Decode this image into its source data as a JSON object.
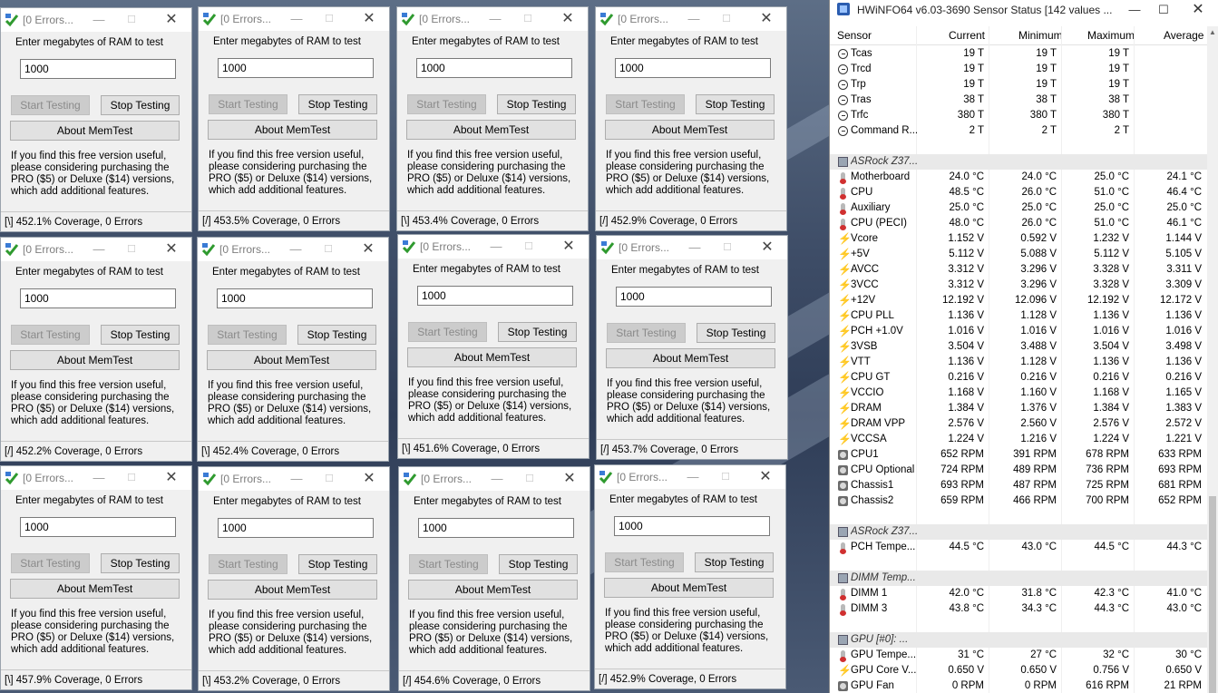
{
  "memtest": {
    "title": "[0 Errors...",
    "prompt": "Enter megabytes of RAM to test",
    "start_label": "Start Testing",
    "stop_label": "Stop Testing",
    "about_label": "About MemTest",
    "description": "If you find this free version useful, please considering purchasing the PRO ($5) or Deluxe ($14) versions, which add additional features.",
    "windows": [
      {
        "ram": "1000",
        "status": "[\\]   452.1% Coverage, 0 Errors"
      },
      {
        "ram": "1000",
        "status": "[/]   453.5% Coverage, 0 Errors"
      },
      {
        "ram": "1000",
        "status": "[\\]   453.4% Coverage, 0 Errors"
      },
      {
        "ram": "1000",
        "status": "[/]   452.9% Coverage, 0 Errors"
      },
      {
        "ram": "1000",
        "status": "[/]   452.2% Coverage, 0 Errors"
      },
      {
        "ram": "1000",
        "status": "[\\]   452.4% Coverage, 0 Errors"
      },
      {
        "ram": "1000",
        "status": "[\\]   451.6% Coverage, 0 Errors"
      },
      {
        "ram": "1000",
        "status": "[/]   453.7% Coverage, 0 Errors"
      },
      {
        "ram": "1000",
        "status": "[\\]   457.9% Coverage, 0 Errors"
      },
      {
        "ram": "1000",
        "status": "[\\]   453.2% Coverage, 0 Errors"
      },
      {
        "ram": "1000",
        "status": "[/]   454.6% Coverage, 0 Errors"
      },
      {
        "ram": "1000",
        "status": "[/]   452.9% Coverage, 0 Errors"
      }
    ]
  },
  "hwinfo": {
    "title": "HWiNFO64 v6.03-3690 Sensor Status [142 values ...",
    "columns": [
      "Sensor",
      "Current",
      "Minimum",
      "Maximum",
      "Average"
    ],
    "rows": [
      {
        "icon": "clock",
        "name": "Tcas",
        "cur": "19 T",
        "min": "19 T",
        "max": "19 T",
        "avg": ""
      },
      {
        "icon": "clock",
        "name": "Trcd",
        "cur": "19 T",
        "min": "19 T",
        "max": "19 T",
        "avg": ""
      },
      {
        "icon": "clock",
        "name": "Trp",
        "cur": "19 T",
        "min": "19 T",
        "max": "19 T",
        "avg": ""
      },
      {
        "icon": "clock",
        "name": "Tras",
        "cur": "38 T",
        "min": "38 T",
        "max": "38 T",
        "avg": ""
      },
      {
        "icon": "clock",
        "name": "Trfc",
        "cur": "380 T",
        "min": "380 T",
        "max": "380 T",
        "avg": ""
      },
      {
        "icon": "clock",
        "name": "Command R...",
        "cur": "2 T",
        "min": "2 T",
        "max": "2 T",
        "avg": ""
      },
      {
        "type": "gap"
      },
      {
        "type": "group",
        "icon": "chip",
        "name": "ASRock Z37..."
      },
      {
        "icon": "therm",
        "name": "Motherboard",
        "cur": "24.0 °C",
        "min": "24.0 °C",
        "max": "25.0 °C",
        "avg": "24.1 °C"
      },
      {
        "icon": "therm",
        "name": "CPU",
        "cur": "48.5 °C",
        "min": "26.0 °C",
        "max": "51.0 °C",
        "avg": "46.4 °C"
      },
      {
        "icon": "therm",
        "name": "Auxiliary",
        "cur": "25.0 °C",
        "min": "25.0 °C",
        "max": "25.0 °C",
        "avg": "25.0 °C"
      },
      {
        "icon": "therm",
        "name": "CPU (PECI)",
        "cur": "48.0 °C",
        "min": "26.0 °C",
        "max": "51.0 °C",
        "avg": "46.1 °C"
      },
      {
        "icon": "bolt",
        "name": "Vcore",
        "cur": "1.152 V",
        "min": "0.592 V",
        "max": "1.232 V",
        "avg": "1.144 V"
      },
      {
        "icon": "bolt",
        "name": "+5V",
        "cur": "5.112 V",
        "min": "5.088 V",
        "max": "5.112 V",
        "avg": "5.105 V"
      },
      {
        "icon": "bolt",
        "name": "AVCC",
        "cur": "3.312 V",
        "min": "3.296 V",
        "max": "3.328 V",
        "avg": "3.311 V"
      },
      {
        "icon": "bolt",
        "name": "3VCC",
        "cur": "3.312 V",
        "min": "3.296 V",
        "max": "3.328 V",
        "avg": "3.309 V"
      },
      {
        "icon": "bolt",
        "name": "+12V",
        "cur": "12.192 V",
        "min": "12.096 V",
        "max": "12.192 V",
        "avg": "12.172 V"
      },
      {
        "icon": "bolt",
        "name": "CPU PLL",
        "cur": "1.136 V",
        "min": "1.128 V",
        "max": "1.136 V",
        "avg": "1.136 V"
      },
      {
        "icon": "bolt",
        "name": "PCH +1.0V",
        "cur": "1.016 V",
        "min": "1.016 V",
        "max": "1.016 V",
        "avg": "1.016 V"
      },
      {
        "icon": "bolt",
        "name": "3VSB",
        "cur": "3.504 V",
        "min": "3.488 V",
        "max": "3.504 V",
        "avg": "3.498 V"
      },
      {
        "icon": "bolt",
        "name": "VTT",
        "cur": "1.136 V",
        "min": "1.128 V",
        "max": "1.136 V",
        "avg": "1.136 V"
      },
      {
        "icon": "bolt",
        "name": "CPU GT",
        "cur": "0.216 V",
        "min": "0.216 V",
        "max": "0.216 V",
        "avg": "0.216 V"
      },
      {
        "icon": "bolt",
        "name": "VCCIO",
        "cur": "1.168 V",
        "min": "1.160 V",
        "max": "1.168 V",
        "avg": "1.165 V"
      },
      {
        "icon": "bolt",
        "name": "DRAM",
        "cur": "1.384 V",
        "min": "1.376 V",
        "max": "1.384 V",
        "avg": "1.383 V"
      },
      {
        "icon": "bolt",
        "name": "DRAM VPP",
        "cur": "2.576 V",
        "min": "2.560 V",
        "max": "2.576 V",
        "avg": "2.572 V"
      },
      {
        "icon": "bolt",
        "name": "VCCSA",
        "cur": "1.224 V",
        "min": "1.216 V",
        "max": "1.224 V",
        "avg": "1.221 V"
      },
      {
        "icon": "fan",
        "name": "CPU1",
        "cur": "652 RPM",
        "min": "391 RPM",
        "max": "678 RPM",
        "avg": "633 RPM"
      },
      {
        "icon": "fan",
        "name": "CPU Optional",
        "cur": "724 RPM",
        "min": "489 RPM",
        "max": "736 RPM",
        "avg": "693 RPM"
      },
      {
        "icon": "fan",
        "name": "Chassis1",
        "cur": "693 RPM",
        "min": "487 RPM",
        "max": "725 RPM",
        "avg": "681 RPM"
      },
      {
        "icon": "fan",
        "name": "Chassis2",
        "cur": "659 RPM",
        "min": "466 RPM",
        "max": "700 RPM",
        "avg": "652 RPM"
      },
      {
        "type": "gap"
      },
      {
        "type": "group",
        "icon": "chip",
        "name": "ASRock Z37..."
      },
      {
        "icon": "therm",
        "name": "PCH Tempe...",
        "cur": "44.5 °C",
        "min": "43.0 °C",
        "max": "44.5 °C",
        "avg": "44.3 °C"
      },
      {
        "type": "gap"
      },
      {
        "type": "group",
        "icon": "chip",
        "name": "DIMM Temp..."
      },
      {
        "icon": "therm",
        "name": "DIMM 1",
        "cur": "42.0 °C",
        "min": "31.8 °C",
        "max": "42.3 °C",
        "avg": "41.0 °C"
      },
      {
        "icon": "therm",
        "name": "DIMM 3",
        "cur": "43.8 °C",
        "min": "34.3 °C",
        "max": "44.3 °C",
        "avg": "43.0 °C"
      },
      {
        "type": "gap"
      },
      {
        "type": "group",
        "icon": "chip",
        "name": "GPU [#0]: ..."
      },
      {
        "icon": "therm",
        "name": "GPU Tempe...",
        "cur": "31 °C",
        "min": "27 °C",
        "max": "32 °C",
        "avg": "30 °C"
      },
      {
        "icon": "bolt",
        "name": "GPU Core V...",
        "cur": "0.650 V",
        "min": "0.650 V",
        "max": "0.756 V",
        "avg": "0.650 V"
      },
      {
        "icon": "fan",
        "name": "GPU Fan",
        "cur": "0 RPM",
        "min": "0 RPM",
        "max": "616 RPM",
        "avg": "21 RPM"
      }
    ]
  }
}
